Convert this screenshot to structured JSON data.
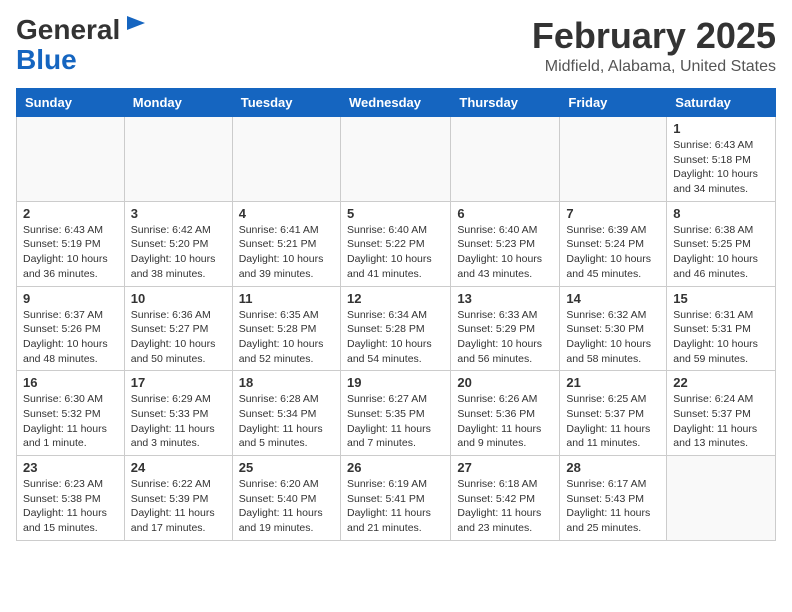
{
  "header": {
    "logo_general": "General",
    "logo_blue": "Blue",
    "month": "February 2025",
    "location": "Midfield, Alabama, United States"
  },
  "weekdays": [
    "Sunday",
    "Monday",
    "Tuesday",
    "Wednesday",
    "Thursday",
    "Friday",
    "Saturday"
  ],
  "weeks": [
    [
      {
        "day": "",
        "info": ""
      },
      {
        "day": "",
        "info": ""
      },
      {
        "day": "",
        "info": ""
      },
      {
        "day": "",
        "info": ""
      },
      {
        "day": "",
        "info": ""
      },
      {
        "day": "",
        "info": ""
      },
      {
        "day": "1",
        "info": "Sunrise: 6:43 AM\nSunset: 5:18 PM\nDaylight: 10 hours\nand 34 minutes."
      }
    ],
    [
      {
        "day": "2",
        "info": "Sunrise: 6:43 AM\nSunset: 5:19 PM\nDaylight: 10 hours\nand 36 minutes."
      },
      {
        "day": "3",
        "info": "Sunrise: 6:42 AM\nSunset: 5:20 PM\nDaylight: 10 hours\nand 38 minutes."
      },
      {
        "day": "4",
        "info": "Sunrise: 6:41 AM\nSunset: 5:21 PM\nDaylight: 10 hours\nand 39 minutes."
      },
      {
        "day": "5",
        "info": "Sunrise: 6:40 AM\nSunset: 5:22 PM\nDaylight: 10 hours\nand 41 minutes."
      },
      {
        "day": "6",
        "info": "Sunrise: 6:40 AM\nSunset: 5:23 PM\nDaylight: 10 hours\nand 43 minutes."
      },
      {
        "day": "7",
        "info": "Sunrise: 6:39 AM\nSunset: 5:24 PM\nDaylight: 10 hours\nand 45 minutes."
      },
      {
        "day": "8",
        "info": "Sunrise: 6:38 AM\nSunset: 5:25 PM\nDaylight: 10 hours\nand 46 minutes."
      }
    ],
    [
      {
        "day": "9",
        "info": "Sunrise: 6:37 AM\nSunset: 5:26 PM\nDaylight: 10 hours\nand 48 minutes."
      },
      {
        "day": "10",
        "info": "Sunrise: 6:36 AM\nSunset: 5:27 PM\nDaylight: 10 hours\nand 50 minutes."
      },
      {
        "day": "11",
        "info": "Sunrise: 6:35 AM\nSunset: 5:28 PM\nDaylight: 10 hours\nand 52 minutes."
      },
      {
        "day": "12",
        "info": "Sunrise: 6:34 AM\nSunset: 5:28 PM\nDaylight: 10 hours\nand 54 minutes."
      },
      {
        "day": "13",
        "info": "Sunrise: 6:33 AM\nSunset: 5:29 PM\nDaylight: 10 hours\nand 56 minutes."
      },
      {
        "day": "14",
        "info": "Sunrise: 6:32 AM\nSunset: 5:30 PM\nDaylight: 10 hours\nand 58 minutes."
      },
      {
        "day": "15",
        "info": "Sunrise: 6:31 AM\nSunset: 5:31 PM\nDaylight: 10 hours\nand 59 minutes."
      }
    ],
    [
      {
        "day": "16",
        "info": "Sunrise: 6:30 AM\nSunset: 5:32 PM\nDaylight: 11 hours\nand 1 minute."
      },
      {
        "day": "17",
        "info": "Sunrise: 6:29 AM\nSunset: 5:33 PM\nDaylight: 11 hours\nand 3 minutes."
      },
      {
        "day": "18",
        "info": "Sunrise: 6:28 AM\nSunset: 5:34 PM\nDaylight: 11 hours\nand 5 minutes."
      },
      {
        "day": "19",
        "info": "Sunrise: 6:27 AM\nSunset: 5:35 PM\nDaylight: 11 hours\nand 7 minutes."
      },
      {
        "day": "20",
        "info": "Sunrise: 6:26 AM\nSunset: 5:36 PM\nDaylight: 11 hours\nand 9 minutes."
      },
      {
        "day": "21",
        "info": "Sunrise: 6:25 AM\nSunset: 5:37 PM\nDaylight: 11 hours\nand 11 minutes."
      },
      {
        "day": "22",
        "info": "Sunrise: 6:24 AM\nSunset: 5:37 PM\nDaylight: 11 hours\nand 13 minutes."
      }
    ],
    [
      {
        "day": "23",
        "info": "Sunrise: 6:23 AM\nSunset: 5:38 PM\nDaylight: 11 hours\nand 15 minutes."
      },
      {
        "day": "24",
        "info": "Sunrise: 6:22 AM\nSunset: 5:39 PM\nDaylight: 11 hours\nand 17 minutes."
      },
      {
        "day": "25",
        "info": "Sunrise: 6:20 AM\nSunset: 5:40 PM\nDaylight: 11 hours\nand 19 minutes."
      },
      {
        "day": "26",
        "info": "Sunrise: 6:19 AM\nSunset: 5:41 PM\nDaylight: 11 hours\nand 21 minutes."
      },
      {
        "day": "27",
        "info": "Sunrise: 6:18 AM\nSunset: 5:42 PM\nDaylight: 11 hours\nand 23 minutes."
      },
      {
        "day": "28",
        "info": "Sunrise: 6:17 AM\nSunset: 5:43 PM\nDaylight: 11 hours\nand 25 minutes."
      },
      {
        "day": "",
        "info": ""
      }
    ]
  ]
}
